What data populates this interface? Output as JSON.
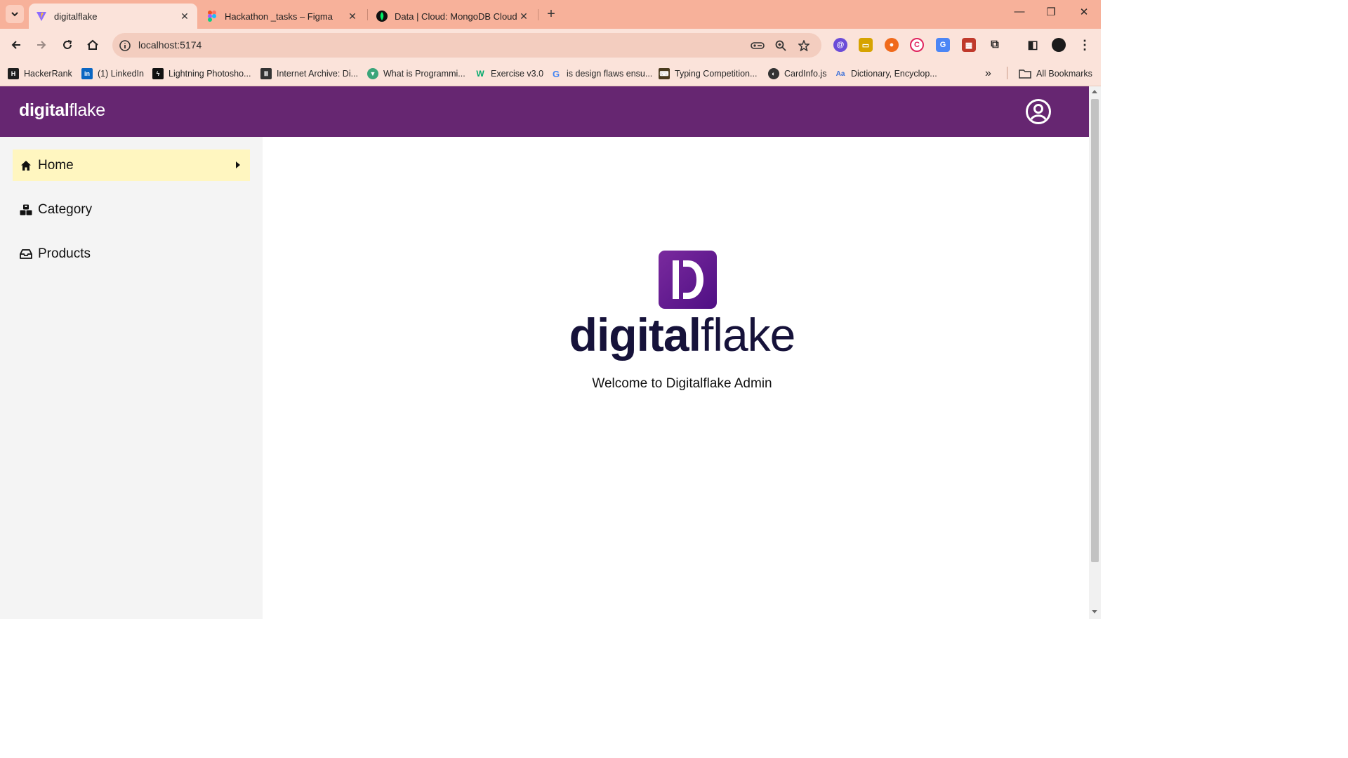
{
  "browser": {
    "tabs": [
      {
        "title": "digitalflake",
        "active": true,
        "favicon": "vite-icon"
      },
      {
        "title": "Hackathon _tasks – Figma",
        "active": false,
        "favicon": "figma-icon"
      },
      {
        "title": "Data | Cloud: MongoDB Cloud",
        "active": false,
        "favicon": "mongodb-icon"
      }
    ],
    "url": "localhost:5174",
    "bookmarks": [
      {
        "label": "HackerRank",
        "icon": "hackerrank-icon",
        "color": "#1f1f1f"
      },
      {
        "label": "(1) LinkedIn",
        "icon": "linkedin-icon",
        "color": "#0a66c2"
      },
      {
        "label": "Lightning Photosho...",
        "icon": "lightning-icon",
        "color": "#111111"
      },
      {
        "label": "Internet Archive: Di...",
        "icon": "archive-icon",
        "color": "#333333"
      },
      {
        "label": "What is Programmi...",
        "icon": "vue-shield-icon",
        "color": "#3aa57a"
      },
      {
        "label": "Exercise v3.0",
        "icon": "w3schools-icon",
        "color": "#04aa6d"
      },
      {
        "label": "is design flaws ensu...",
        "icon": "google-icon",
        "color": "#4285f4"
      },
      {
        "label": "Typing Competition...",
        "icon": "typing-icon",
        "color": "#4a3b1e"
      },
      {
        "label": "CardInfo.js",
        "icon": "globe-icon",
        "color": "#333333"
      },
      {
        "label": "Dictionary, Encyclop...",
        "icon": "dictionary-icon",
        "color": "#3a6fd8"
      }
    ],
    "all_bookmarks": "All Bookmarks"
  },
  "app": {
    "brand_bold": "digital",
    "brand_light": "flake",
    "header_color": "#662671",
    "nav": [
      {
        "label": "Home",
        "icon": "home-icon",
        "active": true
      },
      {
        "label": "Category",
        "icon": "category-icon",
        "active": false
      },
      {
        "label": "Products",
        "icon": "products-icon",
        "active": false
      }
    ],
    "main": {
      "logo_bold": "digital",
      "logo_light": "flake",
      "welcome": "Welcome to Digitalflake Admin"
    }
  }
}
